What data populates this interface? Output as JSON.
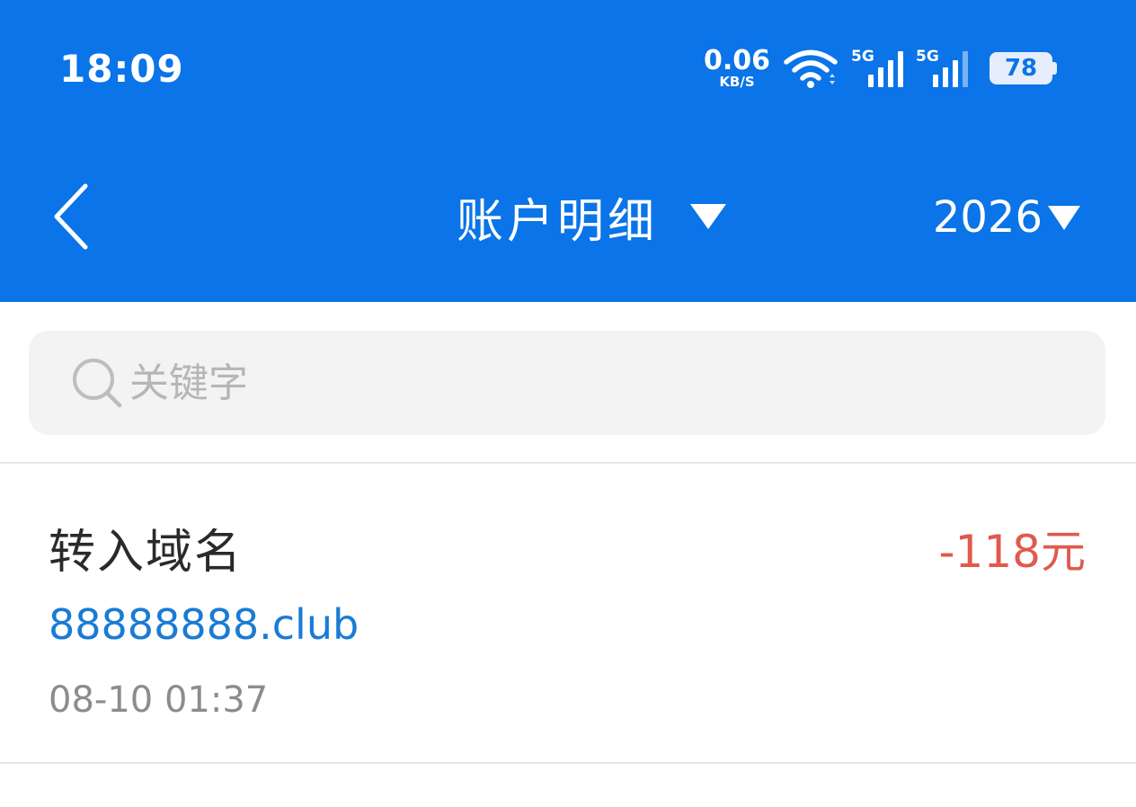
{
  "status_bar": {
    "time": "18:09",
    "net_speed_value": "0.06",
    "net_speed_unit": "KB/S",
    "sim1_tag": "5G",
    "sim2_tag": "5G",
    "battery_level": "78"
  },
  "header": {
    "title": "账户明细",
    "year": "2026"
  },
  "search": {
    "placeholder": "关键字",
    "value": ""
  },
  "records": [
    {
      "title": "转入域名",
      "amount": "-118元",
      "domain": "88888888.club",
      "time": "08-10 01:37"
    }
  ],
  "colors": {
    "header_bg": "#0a74e8",
    "amount_negative": "#e05a4e",
    "link": "#1a7bd4",
    "muted": "#8c8c8c"
  }
}
